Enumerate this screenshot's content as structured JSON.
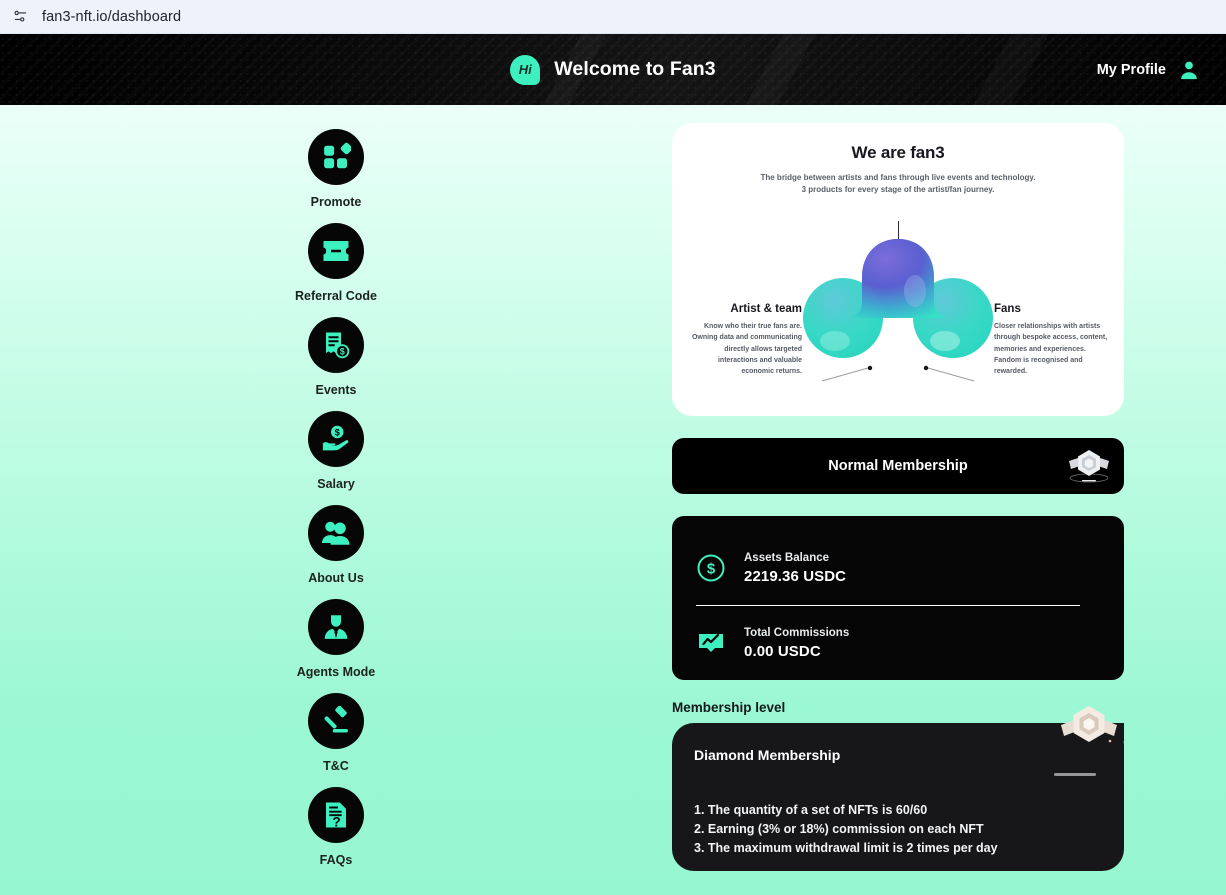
{
  "browser": {
    "url": "fan3-nft.io/dashboard",
    "url_icon": "page-info-icon"
  },
  "header": {
    "logo_text": "Hi",
    "logo_icon": "fan3-speech-bubble-logo",
    "title": "Welcome to Fan3",
    "profile_label": "My Profile",
    "profile_icon": "user-avatar-icon",
    "background_color": "#000000",
    "accent_color": "#3ef0c0"
  },
  "sidebar": {
    "items": [
      {
        "label": "Promote",
        "icon": "grid-squares-icon"
      },
      {
        "label": "Referral Code",
        "icon": "ticket-icon"
      },
      {
        "label": "Events",
        "icon": "receipt-dollar-icon"
      },
      {
        "label": "Salary",
        "icon": "hand-holding-dollar-icon"
      },
      {
        "label": "About Us",
        "icon": "two-people-icon"
      },
      {
        "label": "Agents Mode",
        "icon": "person-in-suit-icon"
      },
      {
        "label": "T&C",
        "icon": "gavel-icon"
      },
      {
        "label": "FAQs",
        "icon": "document-question-icon"
      }
    ]
  },
  "hero": {
    "title": "We are fan3",
    "subtitle_line1": "The bridge between artists and fans through live events and technology.",
    "subtitle_line2": "3 products for every stage of the artist/fan journey.",
    "blob_icon": "three-lobe-gradient-blob",
    "left_column": {
      "heading": "Artist & team",
      "body": "Know who their true fans are. Owning data and communicating directly allows targeted interactions and valuable economic returns."
    },
    "right_column": {
      "heading": "Fans",
      "body": "Closer relationships with artists through bespoke access, content, memories and experiences. Fandom is recognised and rewarded."
    }
  },
  "membership_banner": {
    "label": "Normal Membership",
    "badge_icon": "silver-winged-hexagon-badge"
  },
  "assets": {
    "balance": {
      "label": "Assets Balance",
      "value": "2219.36 USDC",
      "icon": "dollar-circle-icon"
    },
    "commissions": {
      "label": "Total Commissions",
      "value": "0.00 USDC",
      "icon": "chart-board-icon"
    }
  },
  "membership_level": {
    "section_title": "Membership level",
    "level_name": "Diamond Membership",
    "badge_icon": "gold-winged-hexagon-badge",
    "benefits": [
      "1. The quantity of a set of NFTs is 60/60",
      "2. Earning (3% or 18%) commission on each NFT",
      "3. The maximum withdrawal limit is 2 times per day"
    ]
  }
}
